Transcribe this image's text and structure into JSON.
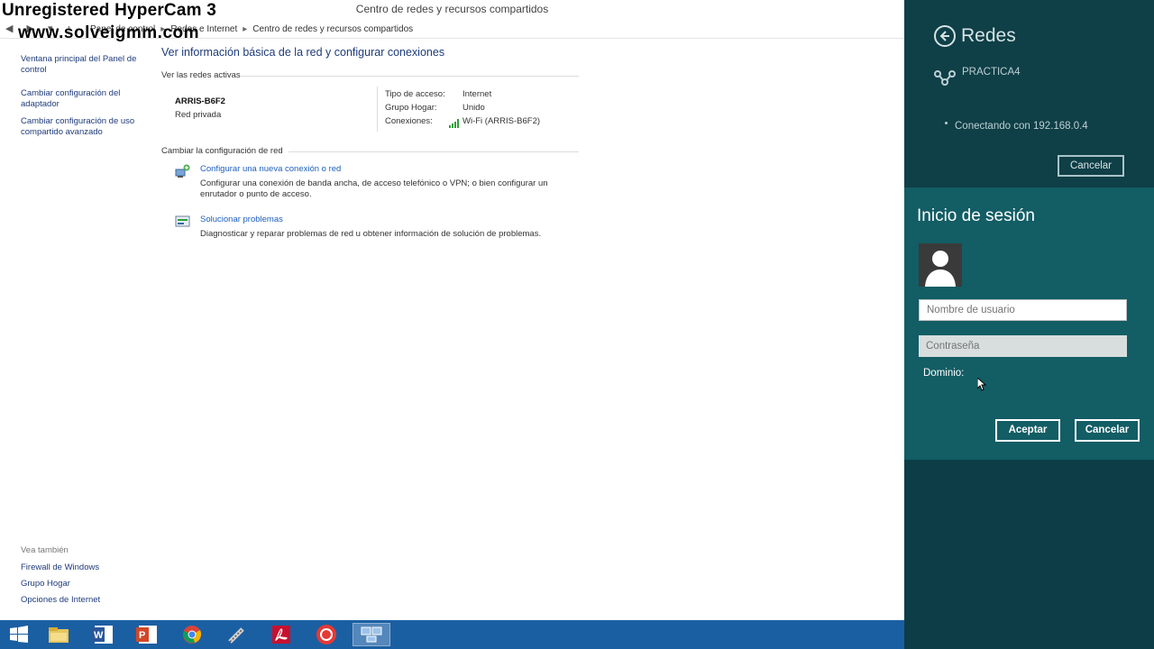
{
  "watermark": {
    "line1": "Unregistered HyperCam 3",
    "line2": "www.solveigmm.com"
  },
  "window": {
    "title": "Centro de redes y recursos compartidos",
    "breadcrumb": [
      "Panel de control",
      "Redes e Internet",
      "Centro de redes y recursos compartidos"
    ]
  },
  "left_nav": {
    "main_link": "Ventana principal del Panel de control",
    "links": [
      "Cambiar configuración del adaptador",
      "Cambiar configuración de uso compartido avanzado"
    ],
    "see_also_label": "Vea también",
    "see_also": [
      "Firewall de Windows",
      "Grupo Hogar",
      "Opciones de Internet"
    ]
  },
  "main": {
    "heading": "Ver información básica de la red y configurar conexiones",
    "active_networks_label": "Ver las redes activas",
    "network": {
      "name": "ARRIS-B6F2",
      "type": "Red privada",
      "access_type_label": "Tipo de acceso:",
      "access_type_value": "Internet",
      "homegroup_label": "Grupo Hogar:",
      "homegroup_value": "Unido",
      "connections_label": "Conexiones:",
      "connections_value": "Wi-Fi (ARRIS-B6F2)"
    },
    "change_settings_label": "Cambiar la configuración de red",
    "tasks": [
      {
        "title": "Configurar una nueva conexión o red",
        "description": "Configurar una conexión de banda ancha, de acceso telefónico o VPN; o bien configurar un enrutador o punto de acceso."
      },
      {
        "title": "Solucionar problemas",
        "description": "Diagnosticar y reparar problemas de red u obtener información de solución de problemas."
      }
    ]
  },
  "charm": {
    "title": "Redes",
    "network_name": "PRACTICA4",
    "status": "Conectando con 192.168.0.4",
    "cancel_top": "Cancelar",
    "signin": {
      "title": "Inicio de sesión",
      "username_placeholder": "Nombre de usuario",
      "password_placeholder": "Contraseña",
      "domain_label": "Dominio:",
      "accept": "Aceptar",
      "cancel": "Cancelar"
    }
  },
  "colors": {
    "charm_bg": "#0f3f47",
    "signin_bg": "#135d65",
    "taskbar_bg": "#1b5fa3",
    "link_blue": "#1e5fbf"
  },
  "taskbar_icons": [
    "windows-start-icon",
    "file-explorer-icon",
    "word-icon",
    "powerpoint-icon",
    "chrome-icon",
    "tool-icon",
    "acrobat-icon",
    "record-icon",
    "network-control-panel-icon"
  ]
}
